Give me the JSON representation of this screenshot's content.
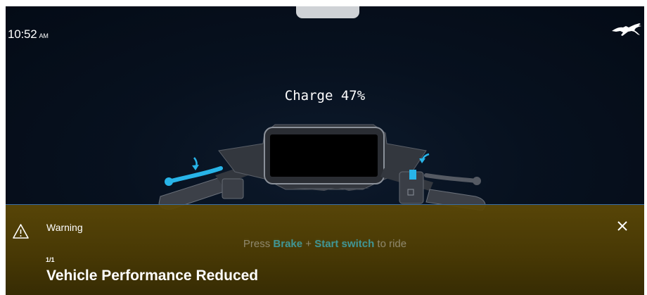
{
  "status_bar": {
    "time": "10:52",
    "ampm": "AM",
    "logo_icon": "horse-logo-icon"
  },
  "charge": {
    "label": "Charge 47%",
    "level_percent": 47
  },
  "ride_hint": {
    "prefix": "Press ",
    "brake": "Brake",
    "plus": " + ",
    "start_switch": "Start switch",
    "suffix": " to ride"
  },
  "warning": {
    "icon": "warning-triangle-icon",
    "title": "Warning",
    "counter": "1/1",
    "message": "Vehicle Performance Reduced",
    "close_icon": "close-icon"
  },
  "colors": {
    "background": "#040b16",
    "highlight": "#2fb7d6",
    "warning_banner": "#5c4806",
    "divider": "#3a6ea5"
  }
}
